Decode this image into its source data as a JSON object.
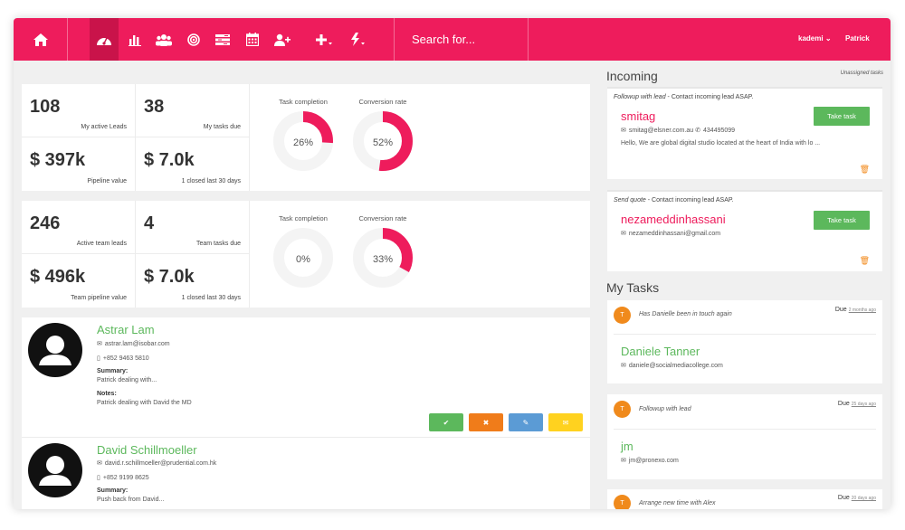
{
  "topbar": {
    "nav_icons": [
      "home-icon",
      "dashboard-icon",
      "bar-chart-icon",
      "users-icon",
      "target-icon",
      "list-icon",
      "calendar-icon",
      "add-user-icon",
      "plus-icon",
      "lightning-icon"
    ],
    "search_placeholder": "Search for...",
    "user_menu": "kademi",
    "user_name": "Patrick"
  },
  "my_stats": {
    "leads": {
      "value": "108",
      "label": "My active Leads"
    },
    "tasks": {
      "value": "38",
      "label": "My tasks due"
    },
    "pipeline": {
      "value": "$ 397k",
      "label": "Pipeline value"
    },
    "closed": {
      "value": "$ 7.0k",
      "label": "1 closed last 30 days"
    },
    "task_completion": {
      "label": "Task completion",
      "percent": 26,
      "text": "26%"
    },
    "conversion": {
      "label": "Conversion rate",
      "percent": 52,
      "text": "52%"
    }
  },
  "team_stats": {
    "leads": {
      "value": "246",
      "label": "Active team leads"
    },
    "tasks": {
      "value": "4",
      "label": "Team tasks due"
    },
    "pipeline": {
      "value": "$ 496k",
      "label": "Team pipeline value"
    },
    "closed": {
      "value": "$ 7.0k",
      "label": "1 closed last 30 days"
    },
    "task_completion": {
      "label": "Task completion",
      "percent": 0,
      "text": "0%"
    },
    "conversion": {
      "label": "Conversion rate",
      "percent": 33,
      "text": "33%"
    }
  },
  "contacts": [
    {
      "name": "Astrar Lam",
      "email": "astrar.lam@isobar.com",
      "phone": "+852 9463 5810",
      "summary_label": "Summary:",
      "summary": "Patrick dealing with...",
      "notes_label": "Notes:",
      "notes": "Patrick dealing with David the MD"
    },
    {
      "name": "David Schillmoeller",
      "email": "david.r.schillmoeller@prudential.com.hk",
      "phone": "+852 9199 8625",
      "summary_label": "Summary:",
      "summary": "Push back from David..."
    }
  ],
  "action_buttons": [
    {
      "name": "check",
      "glyph": "✔",
      "color": "#5cb85c"
    },
    {
      "name": "close",
      "glyph": "✖",
      "color": "#f07c1a"
    },
    {
      "name": "edit",
      "glyph": "✎",
      "color": "#5b9bd5"
    },
    {
      "name": "email",
      "glyph": "✉",
      "color": "#ffd21f"
    }
  ],
  "incoming": {
    "title": "Incoming",
    "note": "Unassigned tasks",
    "take_label": "Take task",
    "cards": [
      {
        "type": "Followup with lead",
        "desc": " - Contact incoming lead ASAP.",
        "name": "smitag",
        "email": "smitag@elsner.com.au",
        "phone": "434495099",
        "message": "Hello, We are global digital studio located at the heart of India with lo ..."
      },
      {
        "type": "Send quote",
        "desc": " - Contact incoming lead ASAP.",
        "name": "nezameddinhassani",
        "email": "nezameddinhassani@gmail.com"
      }
    ]
  },
  "my_tasks": {
    "title": "My Tasks",
    "items": [
      {
        "avatar": "T",
        "title": "Has Danielle been in touch again",
        "due": "Due",
        "when": "2 months ago",
        "name": "Daniele Tanner",
        "email": "daniele@socialmediacollege.com"
      },
      {
        "avatar": "T",
        "title": "Followup with lead",
        "due": "Due",
        "when": "25 days ago",
        "name": "jm",
        "email": "jm@pronexo.com"
      },
      {
        "avatar": "T",
        "title": "Arrange new time with Alex",
        "due": "Due",
        "when": "20 days ago"
      }
    ]
  },
  "colors": {
    "brand": "#ee1c5c",
    "success": "#5cb85c",
    "warning": "#f08a1c"
  }
}
